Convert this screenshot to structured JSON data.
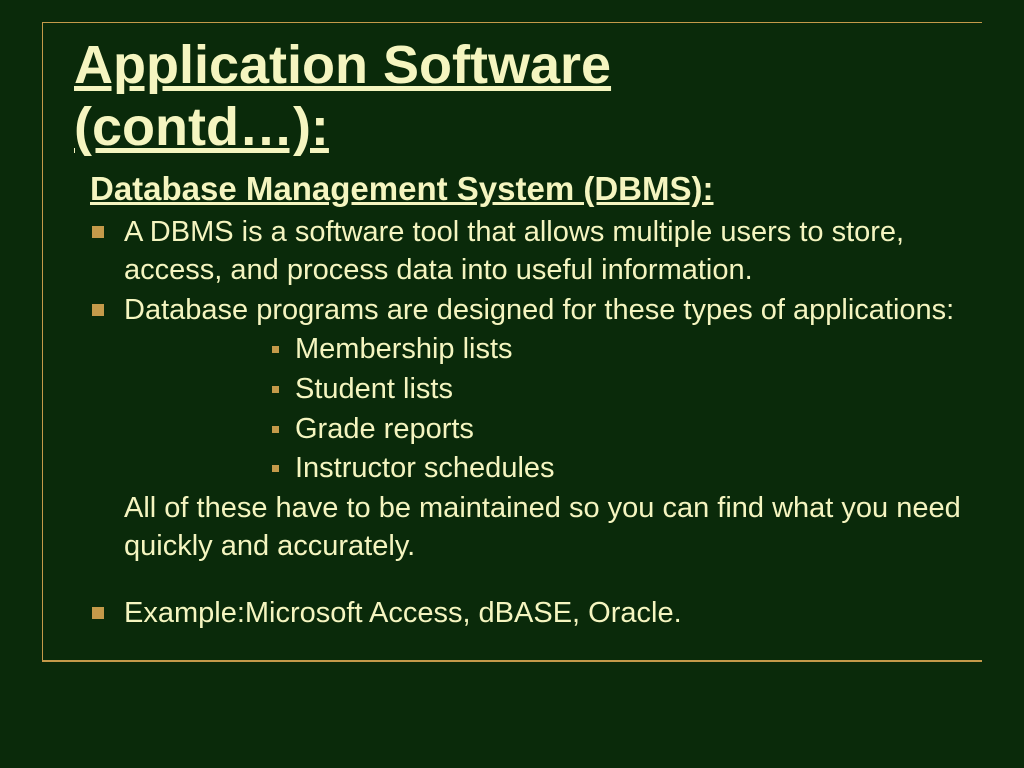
{
  "title_line1": "Application Software",
  "title_line2": "(contd…):",
  "subtitle": "Database Management System (DBMS):",
  "bullet1": "A DBMS is a software tool that allows multiple users to store, access, and process data into useful information.",
  "bullet2": "Database programs are designed for these types of applications:",
  "sub_bullets": [
    "Membership lists",
    "Student lists",
    "Grade reports",
    "Instructor schedules"
  ],
  "followup_text": "All of these have to be maintained so you can find what you need quickly and accurately.",
  "bullet3": "Example:Microsoft Access, dBASE, Oracle."
}
